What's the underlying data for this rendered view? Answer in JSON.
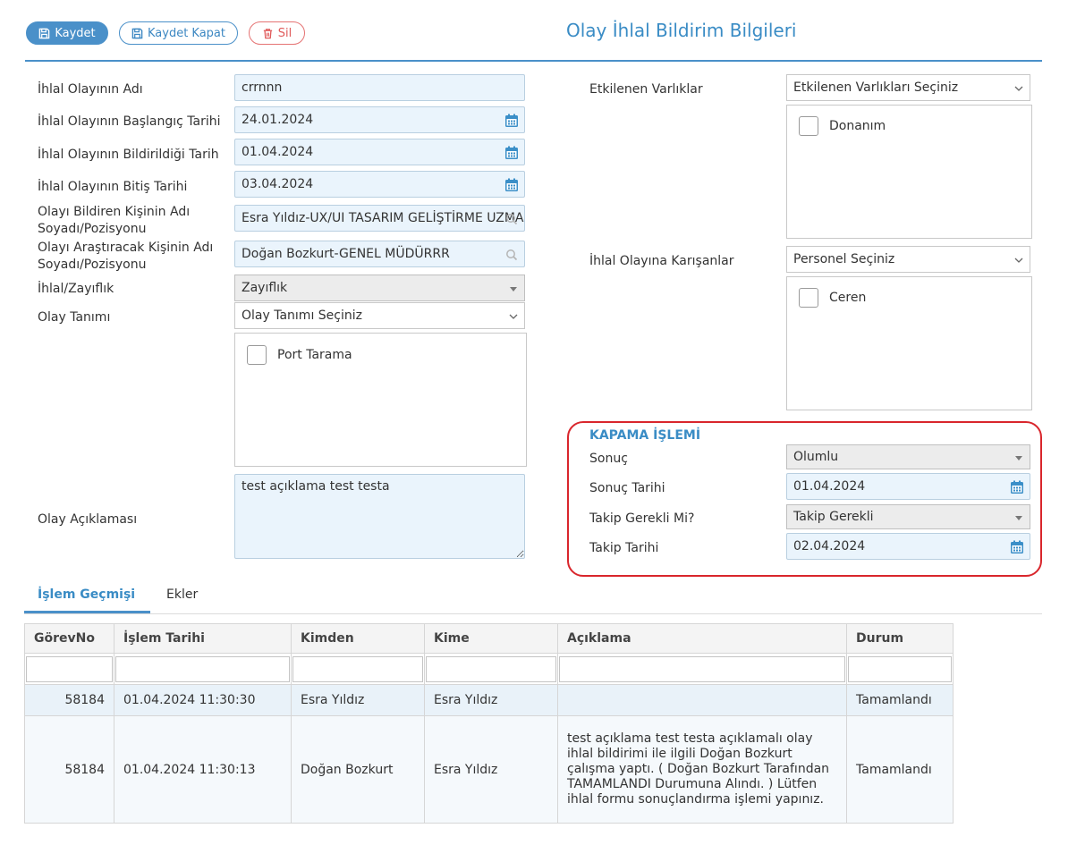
{
  "toolbar": {
    "save_label": "Kaydet",
    "save_close_label": "Kaydet Kapat",
    "delete_label": "Sil"
  },
  "page_title": "Olay İhlal Bildirim Bilgileri",
  "form_left": {
    "name_label": "İhlal Olayının Adı",
    "name_value": "crrnnn",
    "start_label": "İhlal Olayının Başlangıç Tarihi",
    "start_value": "24.01.2024",
    "reported_label": "İhlal Olayının Bildirildiği Tarih",
    "reported_value": "01.04.2024",
    "end_label": "İhlal Olayının Bitiş Tarihi",
    "end_value": "03.04.2024",
    "reporter_label": "Olayı Bildiren Kişinin Adı Soyadı/Pozisyonu",
    "reporter_value": "Esra Yıldız-UX/UI TASARIM GELİŞTİRME UZMANI",
    "investigator_label": "Olayı Araştıracak Kişinin Adı Soyadı/Pozisyonu",
    "investigator_value": "Doğan Bozkurt-GENEL MÜDÜRRR",
    "type_label": "İhlal/Zayıflık",
    "type_value": "Zayıflık",
    "definition_label": "Olay Tanımı",
    "definition_placeholder": "Olay Tanımı Seçiniz",
    "definition_option": "Port Tarama",
    "description_label": "Olay Açıklaması",
    "description_value": "test açıklama test testa"
  },
  "form_right": {
    "assets_label": "Etkilenen Varlıklar",
    "assets_placeholder": "Etkilenen Varlıkları Seçiniz",
    "assets_option": "Donanım",
    "involved_label": "İhlal Olayına Karışanlar",
    "involved_placeholder": "Personel Seçiniz",
    "involved_option": "Ceren"
  },
  "kapama": {
    "title": "KAPAMA İŞLEMİ",
    "result_label": "Sonuç",
    "result_value": "Olumlu",
    "result_date_label": "Sonuç Tarihi",
    "result_date_value": "01.04.2024",
    "followup_label": "Takip Gerekli Mi?",
    "followup_value": "Takip Gerekli",
    "followup_date_label": "Takip Tarihi",
    "followup_date_value": "02.04.2024"
  },
  "tabs": [
    {
      "label": "İşlem Geçmişi",
      "active": true
    },
    {
      "label": "Ekler",
      "active": false
    }
  ],
  "grid": {
    "columns": [
      "GörevNo",
      "İşlem Tarihi",
      "Kimden",
      "Kime",
      "Açıklama",
      "Durum"
    ],
    "rows": [
      {
        "no": "58184",
        "date": "01.04.2024 11:30:30",
        "from": "Esra Yıldız",
        "to": "Esra Yıldız",
        "desc": "",
        "status": "Tamamlandı"
      },
      {
        "no": "58184",
        "date": "01.04.2024 11:30:13",
        "from": "Doğan Bozkurt",
        "to": "Esra Yıldız",
        "desc": "test açıklama test testa açıklamalı olay ihlal bildirimi ile ilgili Doğan Bozkurt çalışma yaptı. ( Doğan Bozkurt Tarafından TAMAMLANDI Durumuna Alındı. ) Lütfen ihlal formu sonuçlandırma işlemi yapınız.",
        "status": "Tamamlandı"
      }
    ]
  },
  "colors": {
    "accent": "#4a90c9",
    "title": "#3a8cc5",
    "danger": "#d9262c",
    "field_bg": "#eaf4fc"
  },
  "icons": [
    "save-icon",
    "trash-icon",
    "calendar-icon",
    "search-icon",
    "chevron-down-icon"
  ]
}
